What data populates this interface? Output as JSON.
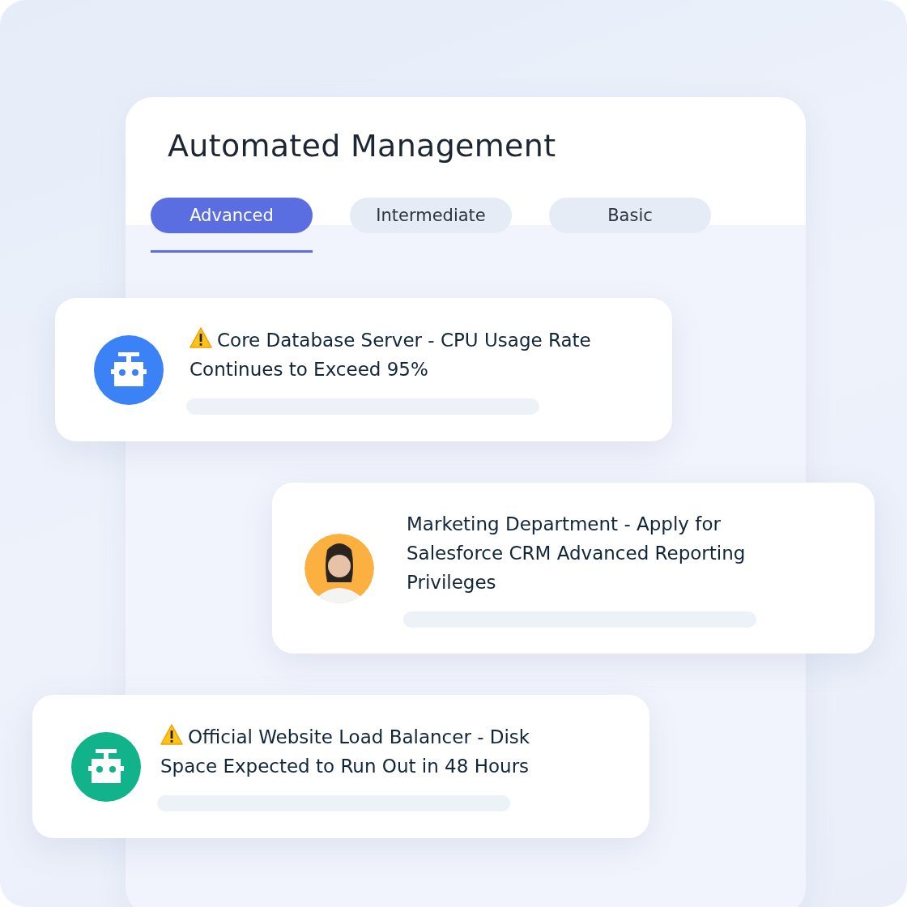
{
  "panel": {
    "title": "Automated Management"
  },
  "tabs": [
    {
      "label": "Advanced",
      "selected": true
    },
    {
      "label": "Intermediate",
      "selected": false
    },
    {
      "label": "Basic",
      "selected": false
    }
  ],
  "cards": [
    {
      "kind": "bot",
      "color": "#3b82f6",
      "warning": true,
      "text": "Core Database Server - CPU Usage Rate Continues to Exceed 95%"
    },
    {
      "kind": "person",
      "warning": false,
      "text": "Marketing Department - Apply for Salesforce CRM Advanced Reporting Privileges"
    },
    {
      "kind": "bot",
      "color": "#10b38a",
      "warning": true,
      "text": "Official Website Load Balancer - Disk Space Expected to Run Out in 48 Hours"
    }
  ]
}
